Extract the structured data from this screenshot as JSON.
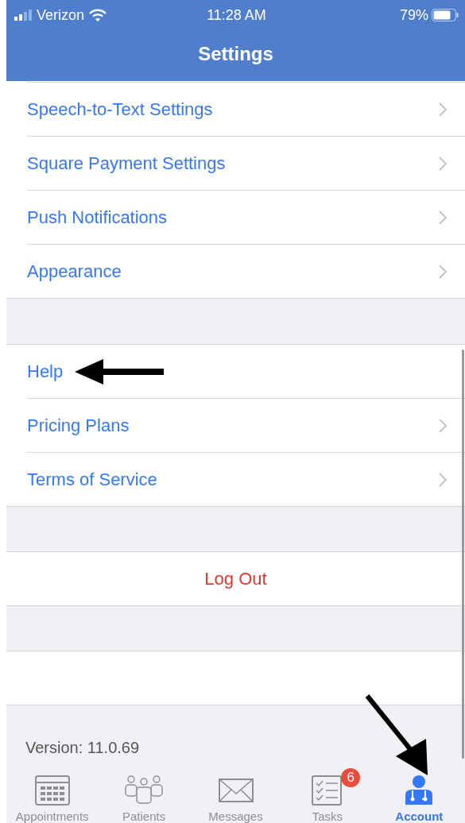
{
  "status_bar": {
    "carrier": "Verizon",
    "time": "11:28 AM",
    "battery": "79%"
  },
  "title": "Settings",
  "sections": [
    {
      "kind": "list",
      "rows": [
        {
          "label": "Speech-to-Text Settings",
          "chevron": true
        },
        {
          "label": "Square Payment Settings",
          "chevron": true
        },
        {
          "label": "Push Notifications",
          "chevron": true
        },
        {
          "label": "Appearance",
          "chevron": true
        }
      ]
    },
    {
      "kind": "list",
      "rows": [
        {
          "label": "Help",
          "chevron": false
        },
        {
          "label": "Pricing Plans",
          "chevron": true
        },
        {
          "label": "Terms of Service",
          "chevron": true
        }
      ]
    },
    {
      "kind": "action",
      "rows": [
        {
          "label": "Log Out"
        }
      ]
    },
    {
      "kind": "blank"
    }
  ],
  "version": "Version: 11.0.69",
  "tabs": [
    {
      "label": "Appointments",
      "selected": false
    },
    {
      "label": "Patients",
      "selected": false
    },
    {
      "label": "Messages",
      "selected": false
    },
    {
      "label": "Tasks",
      "selected": false,
      "badge": "6"
    },
    {
      "label": "Account",
      "selected": true
    }
  ]
}
